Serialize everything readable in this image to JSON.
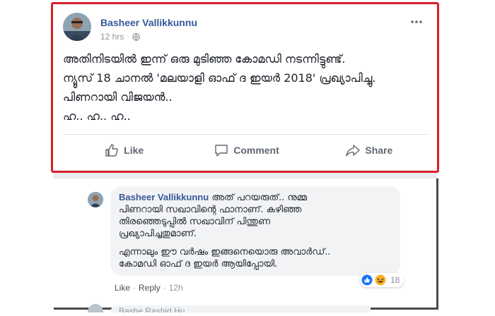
{
  "post": {
    "author": "Basheer Vallikkunnu",
    "time": "12 hrs",
    "meta_separator": "·",
    "privacy_icon": "globe-icon",
    "more_icon": "more-options-icon",
    "lines": [
      "അതിനിടയിൽ ഇന്ന് ഒരു മുടിഞ്ഞ കോമഡി നടന്നിട്ടുണ്ട്.",
      "ന്യൂസ് 18 ചാനൽ 'മലയാളി ഓഫ് ദ ഇയർ 2018' പ്രഖ്യാപിച്ചു.",
      "പിണറായി വിജയൻ..",
      "ഹ.. ഹ.. ഹ.."
    ],
    "actions": {
      "like": "Like",
      "comment": "Comment",
      "share": "Share"
    }
  },
  "comment": {
    "author": "Basheer Vallikkunnu",
    "lines": [
      "അത് പറയരുത്.. നുമ്മ",
      "പിണറായി സഖാവിന്റെ ഫാനാണ്. കഴിഞ്ഞ",
      "തിരഞ്ഞെടുപ്പിൽ സഖാവിന് പിന്തുണ",
      "പ്രഖ്യാപിച്ചതുമാണ്."
    ],
    "lines2": [
      "എന്നാലും ഈ വർഷം ഇങ്ങനെയൊരു അവാർഡ്..",
      "കോമഡി ഓഫ് ദ ഇയർ ആയിപ്പോയി."
    ],
    "like_label": "Like",
    "reply_label": "Reply",
    "separator": "·",
    "time": "12h",
    "reaction_count": "18",
    "reaction_icons": [
      "like-reaction-icon",
      "haha-reaction-icon"
    ]
  },
  "next_comment": {
    "partial_text": "Bashe Rashid Hu..."
  },
  "colors": {
    "highlight_border": "#d9202a",
    "name_link": "#365899",
    "muted": "#90949c",
    "bubble_bg": "#f2f3f5"
  }
}
